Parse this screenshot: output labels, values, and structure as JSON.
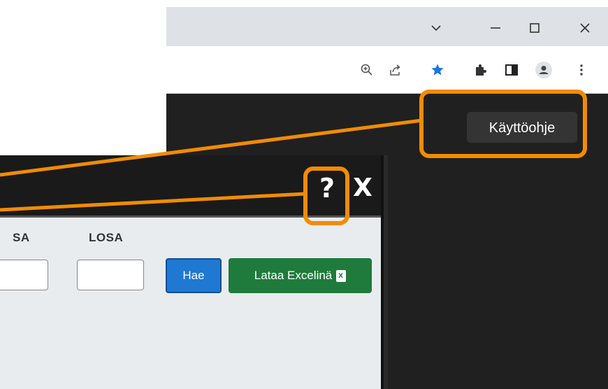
{
  "browser": {
    "window_controls": [
      "chevron-down-icon",
      "minimize-icon",
      "maximize-icon",
      "close-icon"
    ],
    "toolbar_icons": [
      "zoom-icon",
      "share-icon",
      "bookmark-star-icon",
      "extensions-icon",
      "side-panel-icon",
      "profile-icon",
      "menu-icon"
    ],
    "star_color": "#1a73e8"
  },
  "app": {
    "help_button_label": "Käyttöohje"
  },
  "dialog": {
    "help_icon_glyph": "?",
    "close_icon_glyph": "X",
    "fields": [
      {
        "label": "SA",
        "value": ""
      },
      {
        "label": "LOSA",
        "value": ""
      }
    ],
    "search_button_label": "Hae",
    "excel_button_label": "Lataa Excelinä"
  },
  "annotation": {
    "color": "#f28c00"
  }
}
